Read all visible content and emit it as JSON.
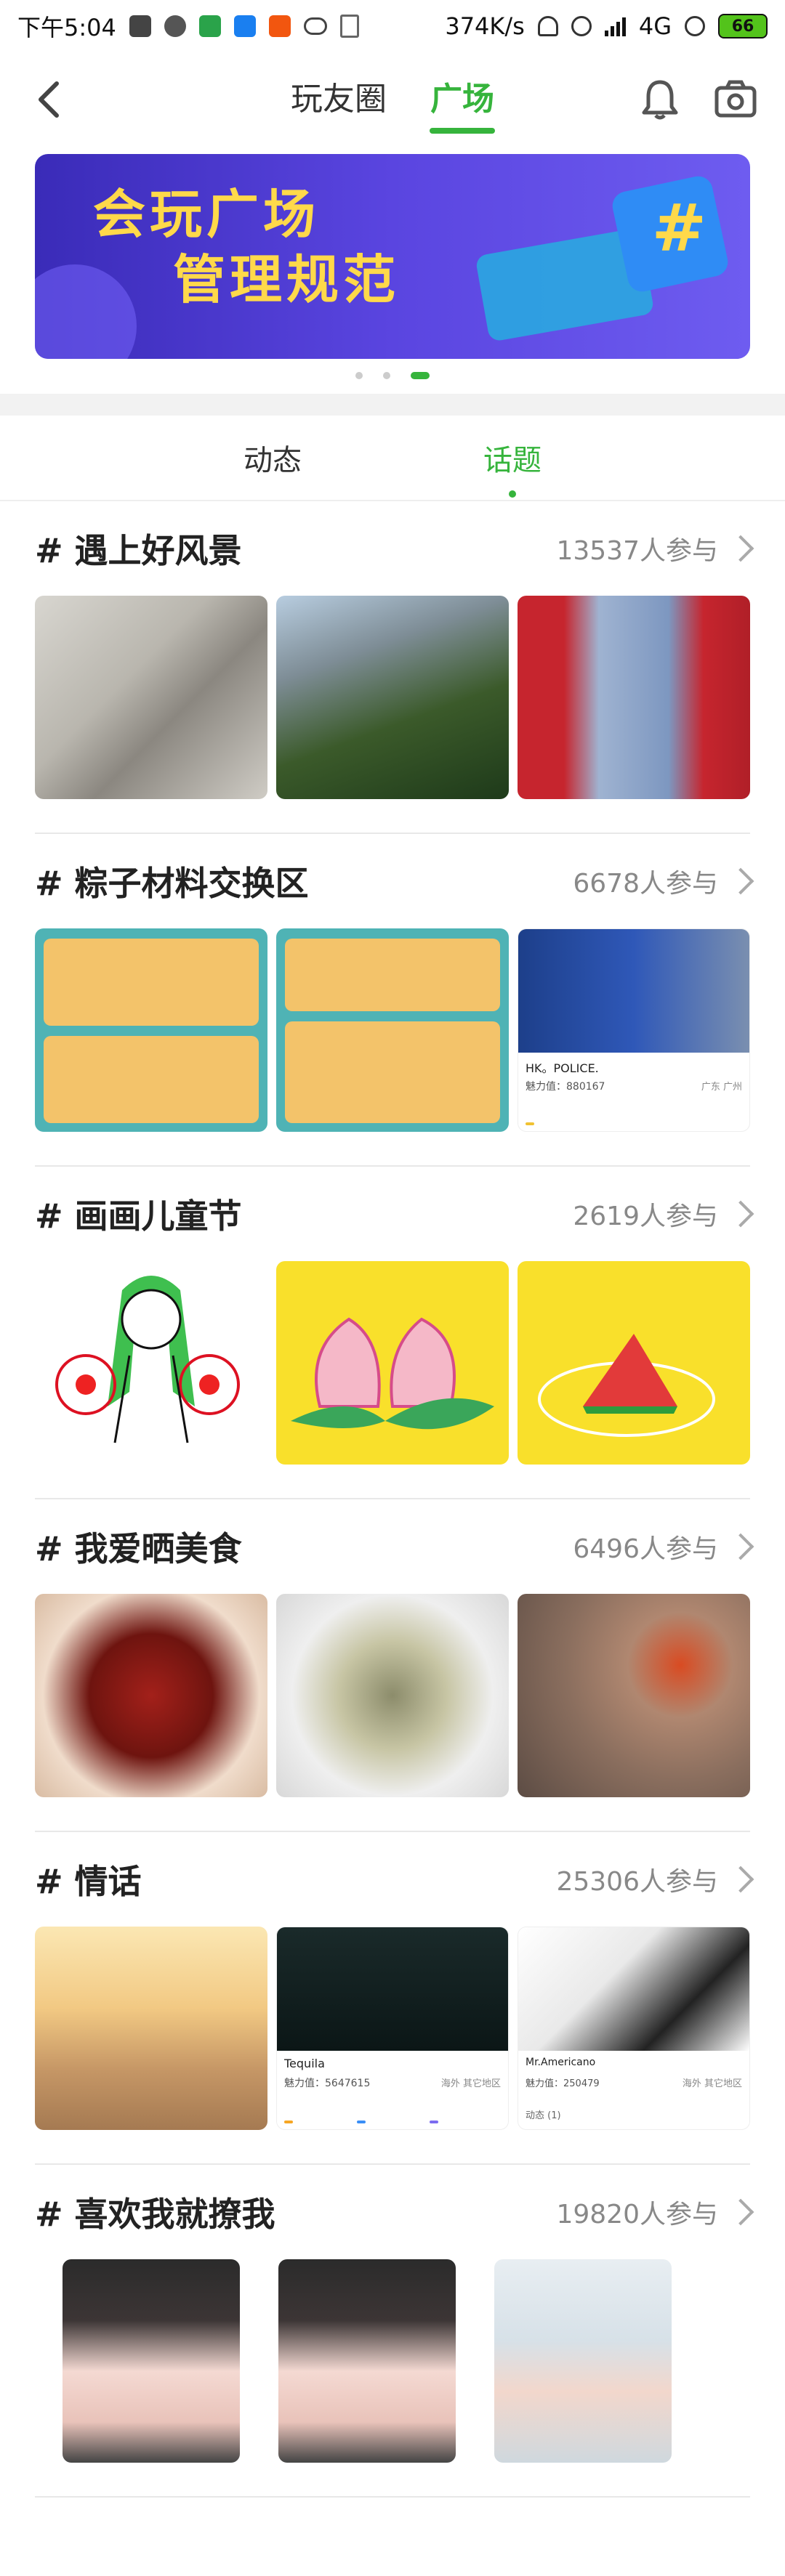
{
  "status": {
    "time": "下午5:04",
    "speed": "374K/s",
    "network": "4G",
    "battery": "66"
  },
  "nav": {
    "tabs": [
      {
        "label": "玩友圈",
        "active": false
      },
      {
        "label": "广场",
        "active": true
      }
    ]
  },
  "banner": {
    "line1": "会玩广场",
    "line2": "管理规范"
  },
  "subtabs": [
    {
      "label": "动态",
      "active": false
    },
    {
      "label": "话题",
      "active": true
    }
  ],
  "topics": [
    {
      "title": "# 遇上好风景",
      "count": "13537人参与"
    },
    {
      "title": "# 粽子材料交换区",
      "count": "6678人参与"
    },
    {
      "title": "# 画画儿童节",
      "count": "2619人参与"
    },
    {
      "title": "# 我爱晒美食",
      "count": "6496人参与"
    },
    {
      "title": "# 情话",
      "count": "25306人参与"
    },
    {
      "title": "# 喜欢我就撩我",
      "count": "19820人参与"
    }
  ],
  "thumb_texts": {
    "zongzi_card_name": "HK。POLICE.",
    "zongzi_card_charm": "魅力值：880167",
    "zongzi_card_loc": "广东 广州",
    "qinghua_card1_name": "Tequila",
    "qinghua_card1_charm": "魅力值：5647615",
    "qinghua_card1_loc": "海外 其它地区",
    "qinghua_card2_name": "Mr.Americano",
    "qinghua_card2_charm": "魅力值：250479",
    "qinghua_card2_loc": "海外 其它地区",
    "qinghua_card2_tab": "动态 (1)"
  },
  "colors": {
    "accent": "#36b43c",
    "banner_bg": "#4a3bd0",
    "banner_text": "#ffd94a"
  }
}
